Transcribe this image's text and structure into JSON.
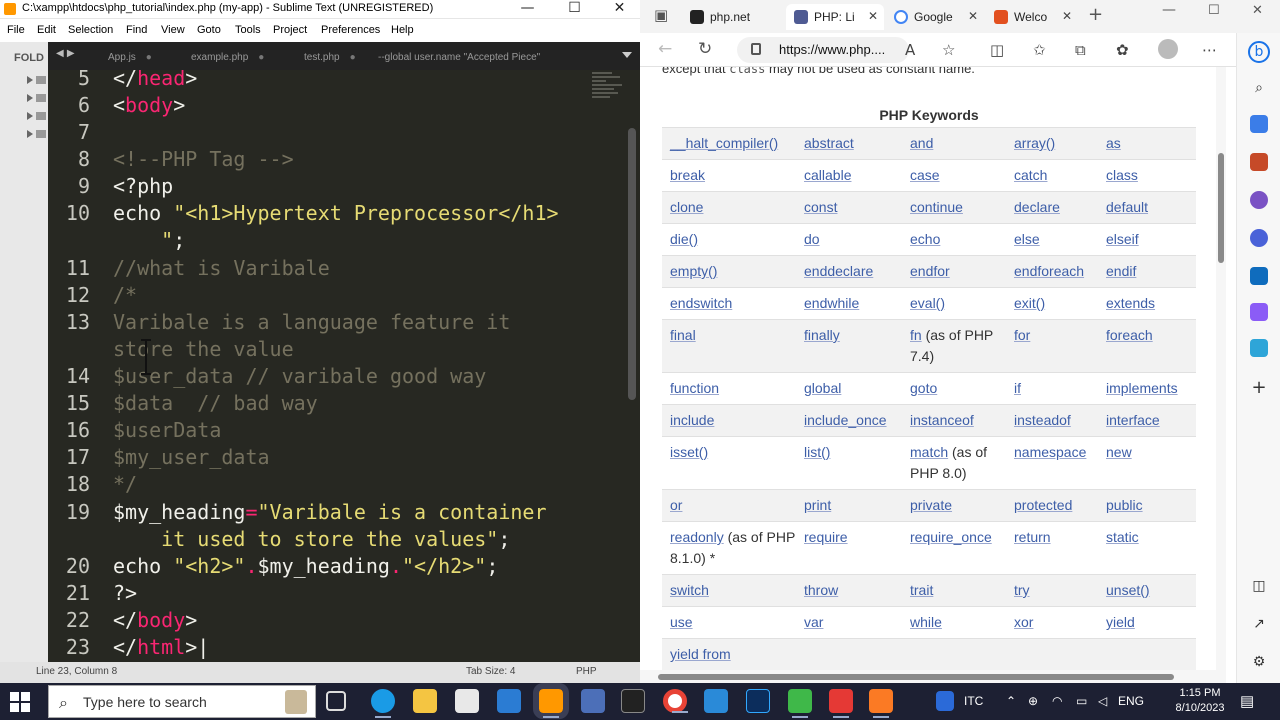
{
  "sublime": {
    "title": "C:\\xampp\\htdocs\\php_tutorial\\index.php (my-app) - Sublime Text (UNREGISTERED)",
    "menu": [
      "File",
      "Edit",
      "Selection",
      "Find",
      "View",
      "Goto",
      "Tools",
      "Project",
      "Preferences",
      "Help"
    ],
    "sidebar_label": "FOLD",
    "tabs": [
      "App.js",
      "example.php",
      "test.php",
      "--global user.name \"Accepted Piece\""
    ],
    "gutter": [
      "5",
      "6",
      "7",
      "8",
      "9",
      "10",
      "11",
      "12",
      "13",
      "14",
      "15",
      "16",
      "17",
      "18",
      "19",
      "20",
      "21",
      "22",
      "23"
    ],
    "status": {
      "position": "Line 23, Column 8",
      "tab_size": "Tab Size: 4",
      "syntax": "PHP"
    }
  },
  "browser": {
    "tabs": [
      {
        "label": "php.net",
        "active": false,
        "favicon_color": "#222222"
      },
      {
        "label": "PHP: Li",
        "active": true,
        "favicon_color": "#4f5b93"
      },
      {
        "label": "Google",
        "active": false,
        "favicon_color": "#4285f4"
      },
      {
        "label": "Welco",
        "active": false,
        "favicon_color": "#e2501f"
      }
    ],
    "url": "https://www.php....",
    "intro_before": "except that ",
    "intro_code": "class",
    "intro_after": " may not be used as constant name.",
    "table_caption": "PHP Keywords",
    "keywords": [
      [
        {
          "k": "__halt_compiler()"
        },
        {
          "k": "abstract"
        },
        {
          "k": "and"
        },
        {
          "k": "array()"
        },
        {
          "k": "as"
        }
      ],
      [
        {
          "k": "break"
        },
        {
          "k": "callable"
        },
        {
          "k": "case"
        },
        {
          "k": "catch"
        },
        {
          "k": "class"
        }
      ],
      [
        {
          "k": "clone"
        },
        {
          "k": "const"
        },
        {
          "k": "continue"
        },
        {
          "k": "declare"
        },
        {
          "k": "default"
        }
      ],
      [
        {
          "k": "die()"
        },
        {
          "k": "do"
        },
        {
          "k": "echo"
        },
        {
          "k": "else"
        },
        {
          "k": "elseif"
        }
      ],
      [
        {
          "k": "empty()"
        },
        {
          "k": "enddeclare"
        },
        {
          "k": "endfor"
        },
        {
          "k": "endforeach"
        },
        {
          "k": "endif"
        }
      ],
      [
        {
          "k": "endswitch"
        },
        {
          "k": "endwhile"
        },
        {
          "k": "eval()"
        },
        {
          "k": "exit()"
        },
        {
          "k": "extends"
        }
      ],
      [
        {
          "k": "final"
        },
        {
          "k": "finally"
        },
        {
          "k": "fn",
          "note": " (as of PHP 7.4)"
        },
        {
          "k": "for"
        },
        {
          "k": "foreach"
        }
      ],
      [
        {
          "k": "function"
        },
        {
          "k": "global"
        },
        {
          "k": "goto"
        },
        {
          "k": "if"
        },
        {
          "k": "implements"
        }
      ],
      [
        {
          "k": "include"
        },
        {
          "k": "include_once"
        },
        {
          "k": "instanceof"
        },
        {
          "k": "insteadof"
        },
        {
          "k": "interface"
        }
      ],
      [
        {
          "k": "isset()"
        },
        {
          "k": "list()"
        },
        {
          "k": "match",
          "note": " (as of PHP 8.0)"
        },
        {
          "k": "namespace"
        },
        {
          "k": "new"
        }
      ],
      [
        {
          "k": "or"
        },
        {
          "k": "print"
        },
        {
          "k": "private"
        },
        {
          "k": "protected"
        },
        {
          "k": "public"
        }
      ],
      [
        {
          "k": "readonly",
          "note": " (as of PHP 8.1.0) *"
        },
        {
          "k": "require"
        },
        {
          "k": "require_once"
        },
        {
          "k": "return"
        },
        {
          "k": "static"
        }
      ],
      [
        {
          "k": "switch"
        },
        {
          "k": "throw"
        },
        {
          "k": "trait"
        },
        {
          "k": "try"
        },
        {
          "k": "unset()"
        }
      ],
      [
        {
          "k": "use"
        },
        {
          "k": "var"
        },
        {
          "k": "while"
        },
        {
          "k": "xor"
        },
        {
          "k": "yield"
        }
      ],
      [
        {
          "k": "yield from"
        },
        {
          "k": ""
        },
        {
          "k": ""
        },
        {
          "k": ""
        },
        {
          "k": ""
        }
      ]
    ]
  },
  "taskbar": {
    "search_placeholder": "Type here to search",
    "tray_label": "ITC",
    "language": "ENG",
    "time": "1:15 PM",
    "date": "8/10/2023"
  }
}
